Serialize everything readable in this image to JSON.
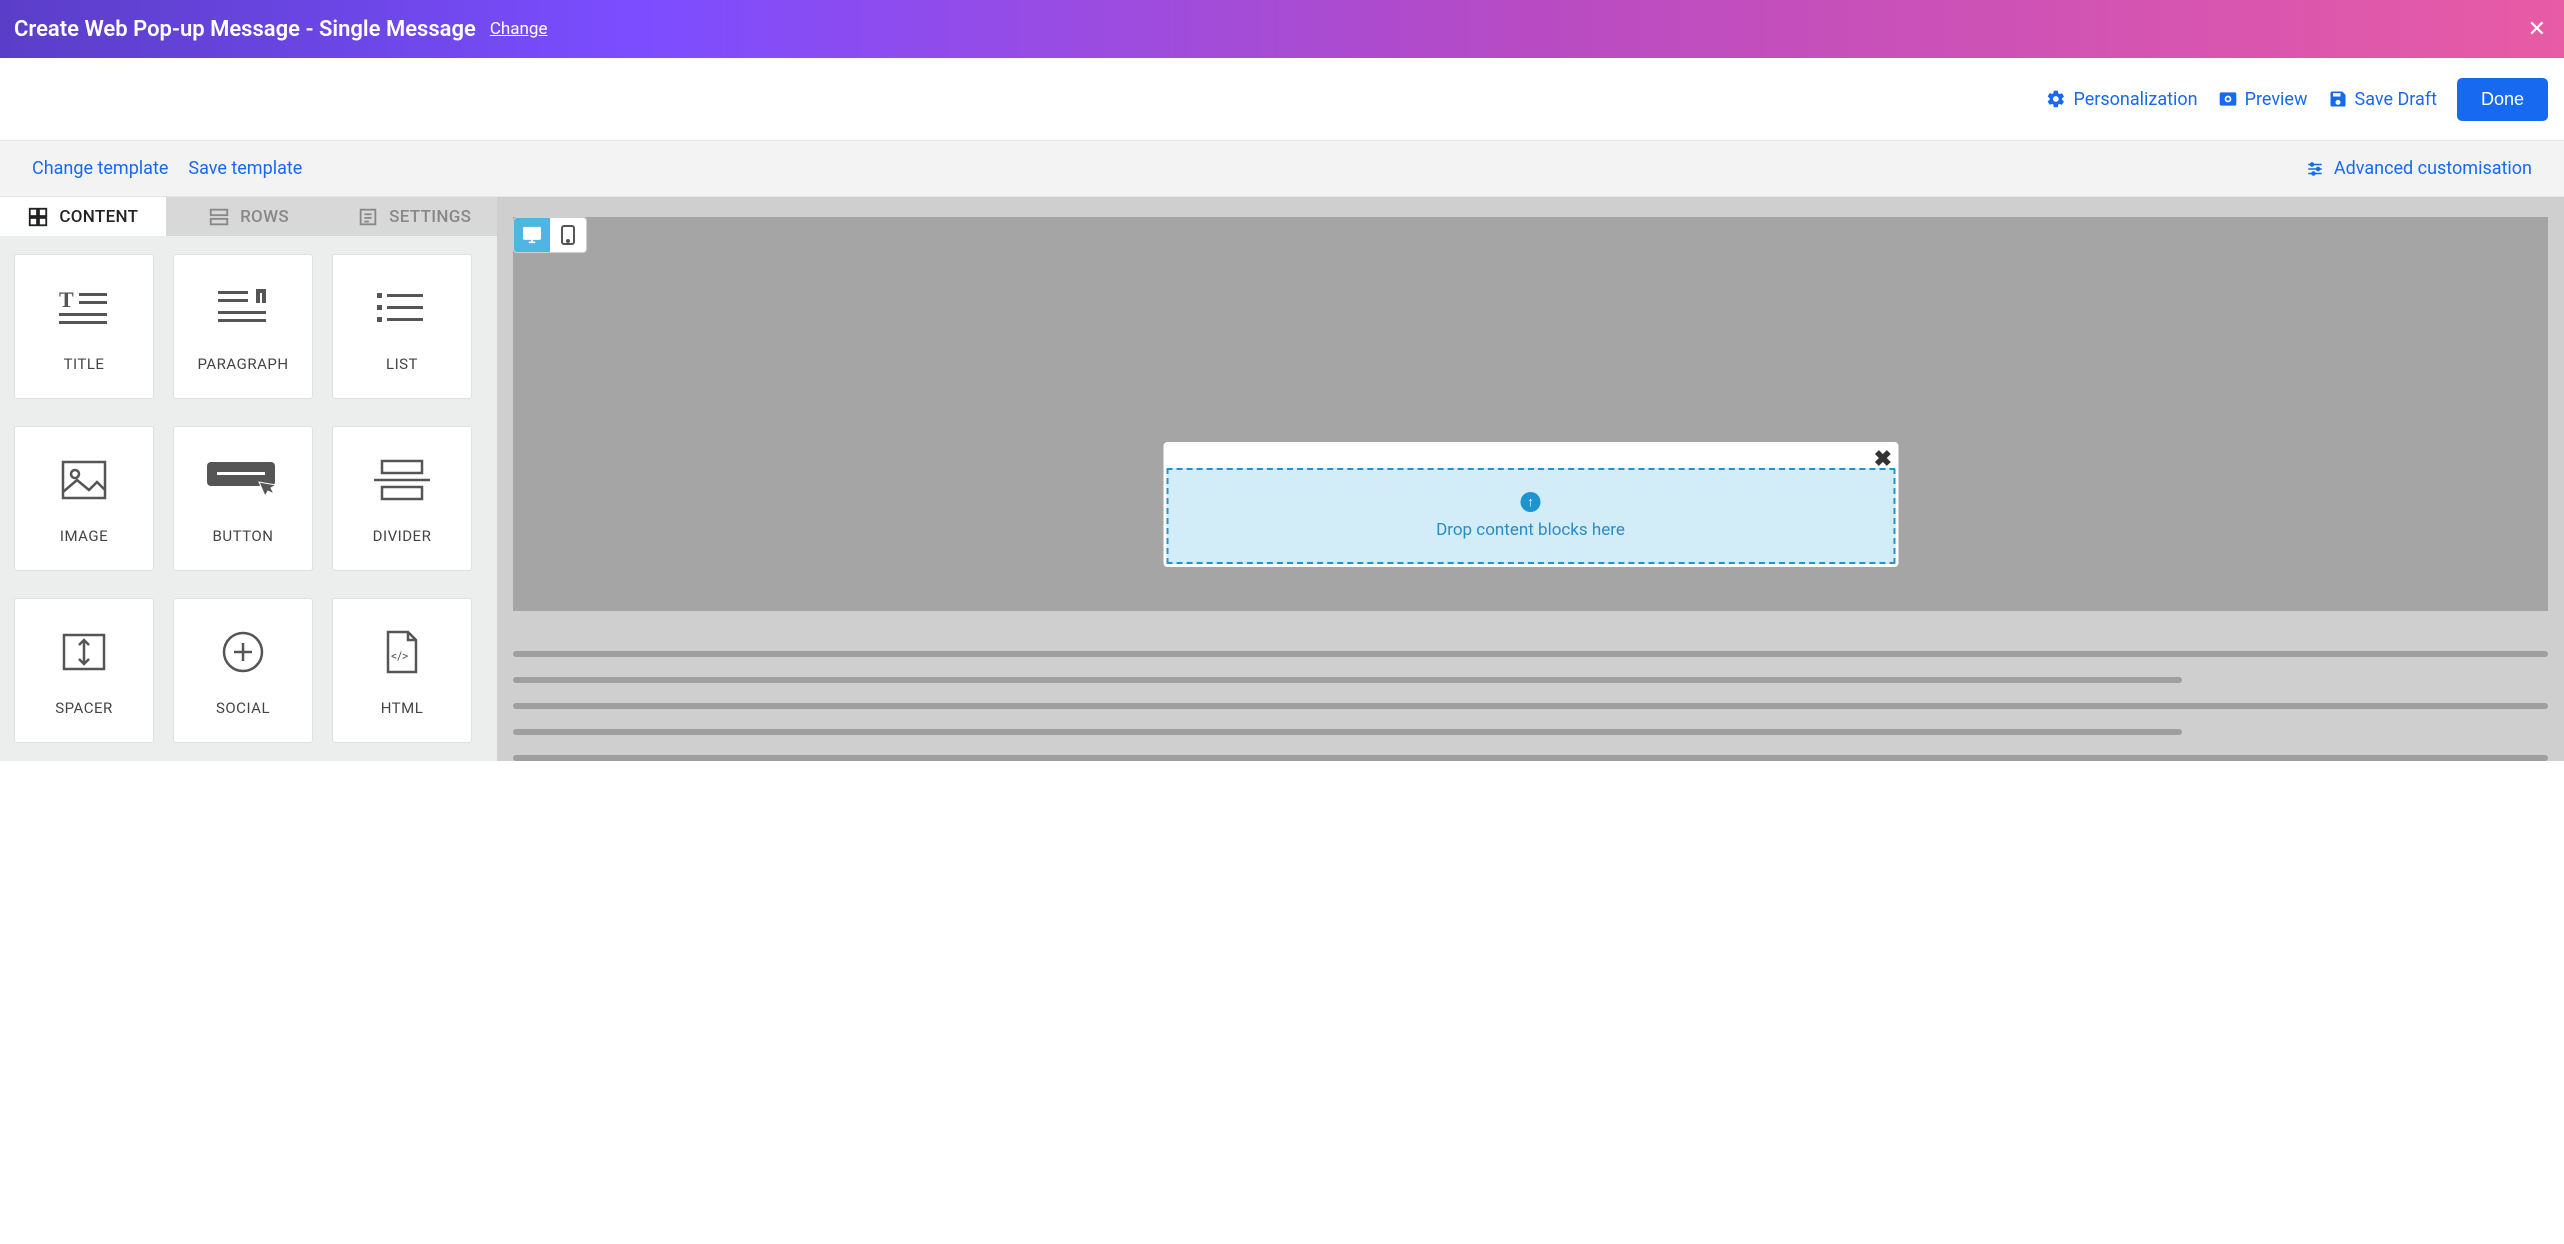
{
  "topbar": {
    "title": "Create Web Pop-up Message - Single Message",
    "change": "Change"
  },
  "actions": {
    "personalization": "Personalization",
    "preview": "Preview",
    "save_draft": "Save Draft",
    "done": "Done"
  },
  "template_bar": {
    "change_template": "Change template",
    "save_template": "Save template",
    "advanced": "Advanced customisation"
  },
  "tabs": {
    "content": "CONTENT",
    "rows": "ROWS",
    "settings": "SETTINGS"
  },
  "blocks": [
    {
      "id": "title",
      "label": "TITLE"
    },
    {
      "id": "paragraph",
      "label": "PARAGRAPH"
    },
    {
      "id": "list",
      "label": "LIST"
    },
    {
      "id": "image",
      "label": "IMAGE"
    },
    {
      "id": "button",
      "label": "BUTTON"
    },
    {
      "id": "divider",
      "label": "DIVIDER"
    },
    {
      "id": "spacer",
      "label": "SPACER"
    },
    {
      "id": "social",
      "label": "SOCIAL"
    },
    {
      "id": "html",
      "label": "HTML"
    }
  ],
  "canvas": {
    "drop_text": "Drop content blocks here"
  }
}
